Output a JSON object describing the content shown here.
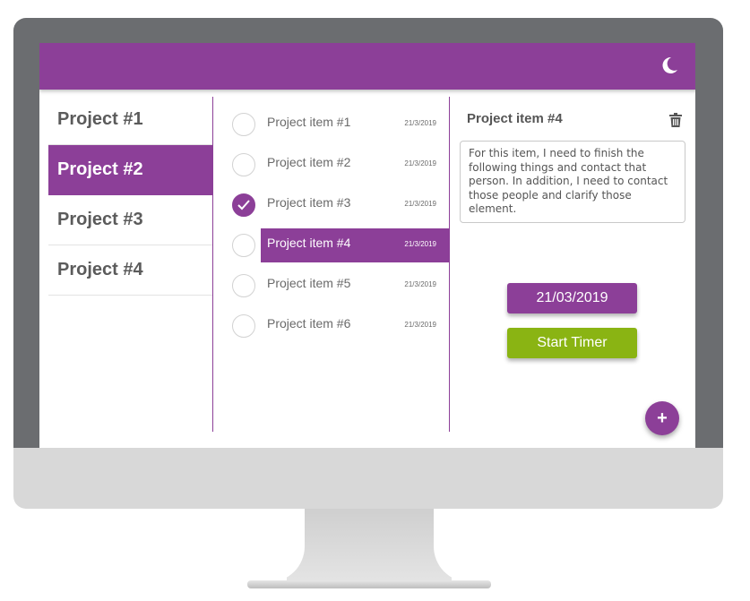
{
  "header": {
    "theme_toggle_icon": "moon-icon"
  },
  "projects": [
    {
      "label": "Project #1",
      "active": false
    },
    {
      "label": "Project #2",
      "active": true
    },
    {
      "label": "Project #3",
      "active": false
    },
    {
      "label": "Project #4",
      "active": false
    }
  ],
  "items": [
    {
      "label": "Project item #1",
      "date": "21/3/2019",
      "done": false,
      "active": false
    },
    {
      "label": "Project item #2",
      "date": "21/3/2019",
      "done": false,
      "active": false
    },
    {
      "label": "Project item #3",
      "date": "21/3/2019",
      "done": true,
      "active": false
    },
    {
      "label": "Project item #4",
      "date": "21/3/2019",
      "done": false,
      "active": true
    },
    {
      "label": "Project item #5",
      "date": "21/3/2019",
      "done": false,
      "active": false
    },
    {
      "label": "Project item #6",
      "date": "21/3/2019",
      "done": false,
      "active": false
    }
  ],
  "detail": {
    "title": "Project item #4",
    "notes": "For this item, I need to finish the following things and contact that person. In addition, I need to contact those people and clarify those element.",
    "date_button": "21/03/2019",
    "timer_button": "Start Timer",
    "delete_icon": "trash-icon",
    "add_label": "+"
  },
  "colors": {
    "accent": "#8c3f98",
    "timer": "#8ab413",
    "bezel": "#6b6d70",
    "chin": "#d8d8d8"
  }
}
